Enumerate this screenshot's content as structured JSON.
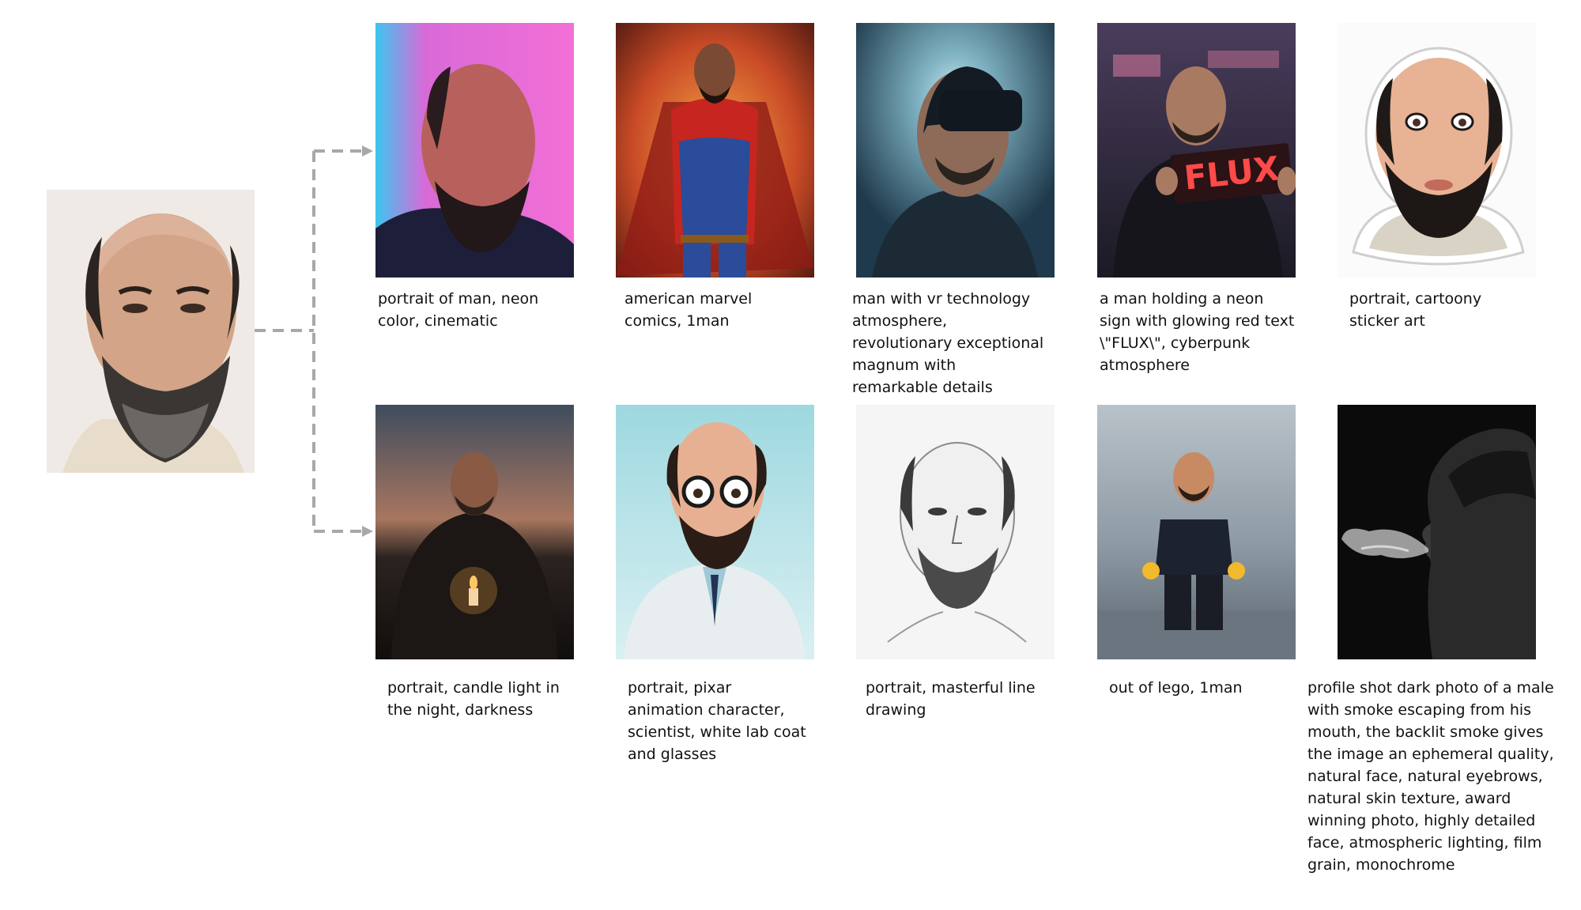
{
  "reference": {
    "icon": "bald-bearded-man-photo"
  },
  "row1": [
    {
      "icon": "neon-portrait-photo",
      "caption": "portrait of man, neon\ncolor, cinematic"
    },
    {
      "icon": "superhero-illustration",
      "caption": "american marvel\ncomics, 1man"
    },
    {
      "icon": "vr-headset-photo",
      "caption": "man with vr technology\natmosphere,\nrevolutionary exceptional\nmagnum with\nremarkable details"
    },
    {
      "icon": "neon-sign-flux-photo",
      "sign_text": "FLUX",
      "caption": "a man holding a neon\nsign with glowing red text\n\\\"FLUX\\\", cyberpunk\natmosphere"
    },
    {
      "icon": "cartoon-sticker",
      "caption": "portrait, cartoony\nsticker art"
    }
  ],
  "row2": [
    {
      "icon": "candle-night-photo",
      "caption": "portrait, candle light in\nthe night, darkness"
    },
    {
      "icon": "pixar-scientist-render",
      "caption": "portrait, pixar\nanimation character,\nscientist, white lab coat\nand glasses"
    },
    {
      "icon": "line-drawing-sketch",
      "caption": "portrait, masterful line\ndrawing"
    },
    {
      "icon": "lego-minifigure-photo",
      "caption": "out of lego, 1man"
    },
    {
      "icon": "smoke-profile-photo",
      "caption": "profile shot dark photo of a male\nwith smoke escaping from his\nmouth, the backlit smoke gives\nthe image an ephemeral quality,\nnatural face, natural eyebrows,\nnatural skin texture, award\nwinning photo, highly detailed\nface, atmospheric lighting, film\ngrain, monochrome"
    }
  ],
  "colors": {
    "connector": "#a8a8a8",
    "caption_text": "#111111"
  }
}
